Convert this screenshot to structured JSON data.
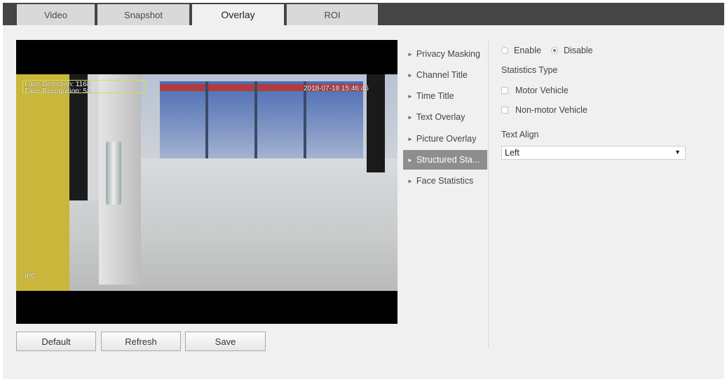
{
  "tabs": [
    {
      "label": "Video",
      "active": false
    },
    {
      "label": "Snapshot",
      "active": false
    },
    {
      "label": "Overlay",
      "active": true
    },
    {
      "label": "ROI",
      "active": false
    }
  ],
  "video": {
    "osd_face_detection": "Face Detection: 1168",
    "osd_face_recognition": "Face Recognition: 58",
    "osd_timestamp": "2018-07-18 15:46:46",
    "osd_label": "IPC"
  },
  "buttons": {
    "default": "Default",
    "refresh": "Refresh",
    "save": "Save"
  },
  "menu": [
    {
      "label": "Privacy Masking",
      "active": false
    },
    {
      "label": "Channel Title",
      "active": false
    },
    {
      "label": "Time Title",
      "active": false
    },
    {
      "label": "Text Overlay",
      "active": false
    },
    {
      "label": "Picture Overlay",
      "active": false
    },
    {
      "label": "Structured Sta...",
      "active": true
    },
    {
      "label": "Face Statistics",
      "active": false
    }
  ],
  "panel": {
    "enable_label": "Enable",
    "disable_label": "Disable",
    "selected_state": "Disable",
    "statistics_type_label": "Statistics Type",
    "motor_vehicle_label": "Motor Vehicle",
    "non_motor_vehicle_label": "Non-motor Vehicle",
    "motor_vehicle_checked": false,
    "non_motor_vehicle_checked": false,
    "text_align_label": "Text Align",
    "text_align_value": "Left"
  },
  "colors": {
    "tabbar": "#444547",
    "active_menu": "#8e8e8e",
    "face_box": "#d7e040"
  }
}
